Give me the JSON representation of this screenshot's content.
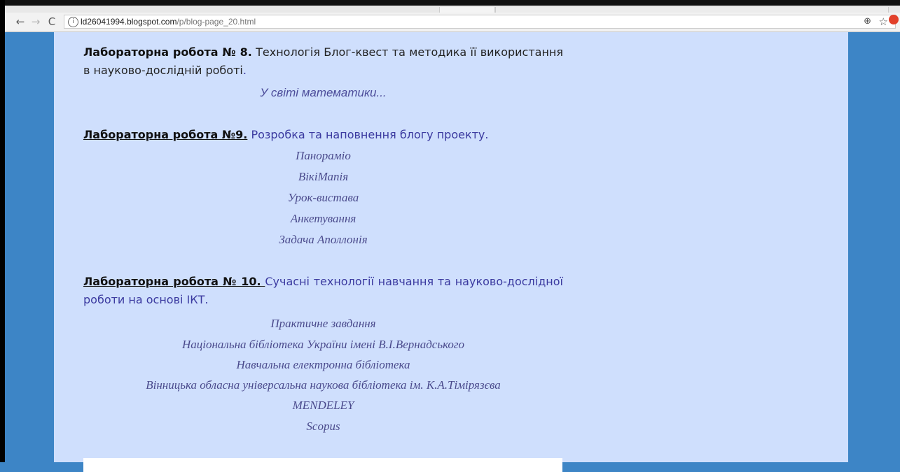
{
  "browser": {
    "url_host": "ld26041994.blogspot.com",
    "url_path": "/p/blog-page_20.html"
  },
  "lab8": {
    "title": "Лабораторна робота № 8.",
    "text": " Технологія Блог-квест та методика її використання в науково-дослідній роботі",
    "period": ".",
    "link": "У світі математики..."
  },
  "lab9": {
    "title": "Лабораторна робота №9.",
    "text": " Розробка та наповнення блогу проекту.",
    "links": [
      "Панораміо",
      "ВікіМапія",
      "Урок-вистава",
      "Анкетування",
      "Задача Аполлонія"
    ]
  },
  "lab10": {
    "title": "Лабораторна робота № 10.",
    "title_space": " ",
    "text": "Сучасні технології навчання та науково-дослідної роботи на основі ІКТ.",
    "links": [
      "Практичне завдання",
      "Національна бібліотека України імені В.І.Вернадського",
      "Навчальна електронна бібліотека",
      "Вінницька обласна універсальна наукова бібліотека ім. К.А.Тімірязєва",
      "MENDELEY",
      "Scopus"
    ]
  }
}
